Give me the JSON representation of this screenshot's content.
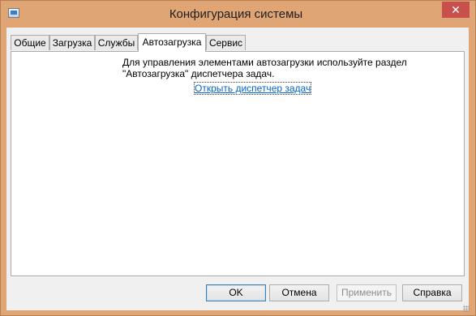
{
  "window": {
    "title": "Конфигурация системы",
    "close_glyph": "✕",
    "frame_color": "#e0a574"
  },
  "tabs": [
    {
      "label": "Общие"
    },
    {
      "label": "Загрузка"
    },
    {
      "label": "Службы"
    },
    {
      "label": "Автозагрузка",
      "active": true
    },
    {
      "label": "Сервис"
    }
  ],
  "panel": {
    "message_line1": "Для управления элементами автозагрузки используйте раздел",
    "message_line2": "\"Автозагрузка\" диспетчера задач.",
    "link_text": "Открыть диспетчер задач"
  },
  "buttons": {
    "ok": "OK",
    "cancel": "Отмена",
    "apply": "Применить",
    "help": "Справка"
  },
  "icons": {
    "app": "system-configuration-icon",
    "close": "close-icon",
    "grip": "resize-grip-icon"
  }
}
